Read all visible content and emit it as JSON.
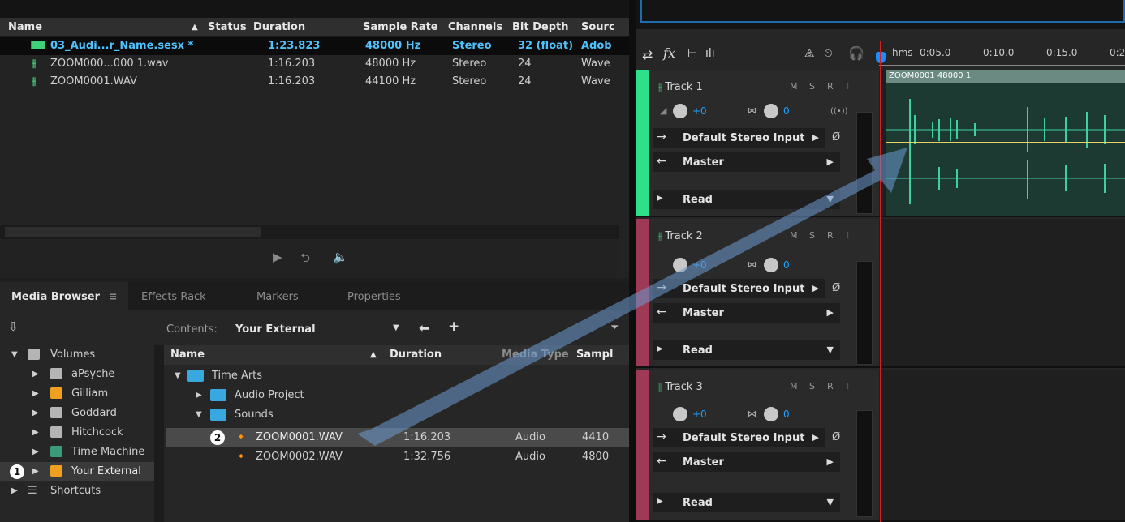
{
  "files": {
    "columns": [
      "Name",
      "Status",
      "Duration",
      "Sample Rate",
      "Channels",
      "Bit Depth",
      "Sourc"
    ],
    "rows": [
      {
        "name": "03_Audi...r_Name.sesx *",
        "duration": "1:23.823",
        "sample_rate": "48000 Hz",
        "channels": "Stereo",
        "bit_depth": "32 (float)",
        "source": "Adob"
      },
      {
        "name": "ZOOM000...000 1.wav",
        "duration": "1:16.203",
        "sample_rate": "48000 Hz",
        "channels": "Stereo",
        "bit_depth": "24",
        "source": "Wave"
      },
      {
        "name": "ZOOM0001.WAV",
        "duration": "1:16.203",
        "sample_rate": "44100 Hz",
        "channels": "Stereo",
        "bit_depth": "24",
        "source": "Wave"
      }
    ]
  },
  "media_browser": {
    "tabs": [
      "Media Browser",
      "Effects Rack",
      "Markers",
      "Properties"
    ],
    "contents_label": "Contents:",
    "contents_value": "Your External",
    "columns": [
      "Name",
      "Duration",
      "Media Type",
      "Sampl"
    ],
    "volumes_header": "Volumes",
    "volumes": [
      "aPsyche",
      "Gilliam",
      "Goddard",
      "Hitchcock",
      "Time Machine",
      "Your External"
    ],
    "shortcuts": "Shortcuts",
    "tree": {
      "root": "Time Arts",
      "folder1": "Audio Project",
      "folder2": "Sounds",
      "files": [
        {
          "name": "ZOOM0001.WAV",
          "duration": "1:16.203",
          "type": "Audio",
          "sample": "4410"
        },
        {
          "name": "ZOOM0002.WAV",
          "duration": "1:32.756",
          "type": "Audio",
          "sample": "4800"
        }
      ]
    },
    "badge1": "1",
    "badge2": "2"
  },
  "editor": {
    "ruler": [
      "hms",
      "0:05.0",
      "0:10.0",
      "0:15.0",
      "0:2"
    ],
    "clip_title": "ZOOM0001 48000 1",
    "tracks": [
      {
        "name": "Track 1",
        "vol": "+0",
        "pan": "0",
        "input": "Default Stereo Input",
        "output": "Master",
        "mode": "Read",
        "color": "#2ee08a"
      },
      {
        "name": "Track 2",
        "vol": "+0",
        "pan": "0",
        "input": "Default Stereo Input",
        "output": "Master",
        "mode": "Read",
        "color": "#9e3a55"
      },
      {
        "name": "Track 3",
        "vol": "+0",
        "pan": "0",
        "input": "Default Stereo Input",
        "output": "Master",
        "mode": "Read",
        "color": "#9e3a55"
      }
    ],
    "msr": [
      "M",
      "S",
      "R",
      "I"
    ]
  },
  "colors": {
    "accent": "#4fc3ff",
    "playhead": "#d42020",
    "waveform": "#3fd0a0"
  }
}
